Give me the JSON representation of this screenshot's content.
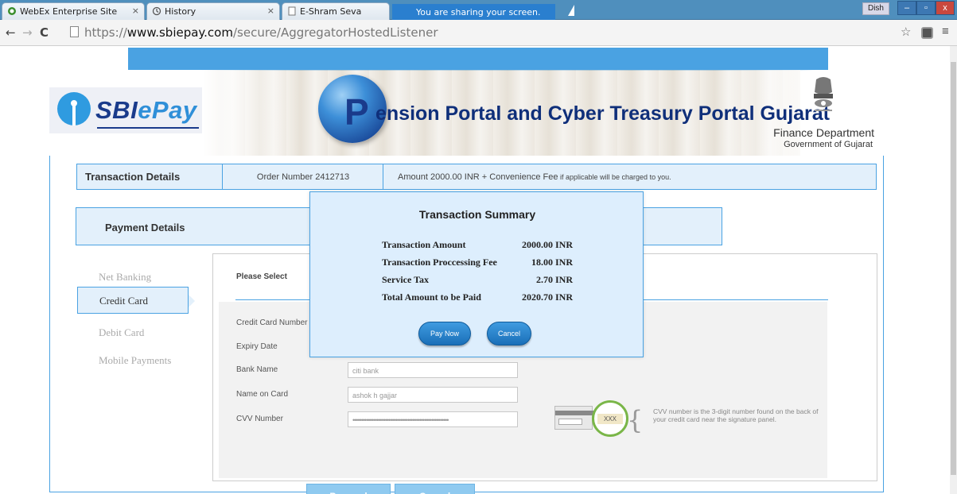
{
  "browser": {
    "tabs": [
      {
        "label": "WebEx Enterprise Site"
      },
      {
        "label": "History"
      },
      {
        "label": "E-Shram Seva"
      }
    ],
    "share_banner": "You are sharing your screen.",
    "user_badge": "Dish",
    "url_prefix": "https://",
    "url_host": "www.sbiepay.com",
    "url_path": "/secure/AggregatorHostedListener"
  },
  "header": {
    "logo_text_dark": "SBI",
    "logo_text_blue": "ePay",
    "portal_initial": "P",
    "portal_title": "ension Portal and Cyber Treasury Portal Gujarat",
    "department": "Finance Department",
    "government": "Government of Gujarat"
  },
  "transaction": {
    "label": "Transaction Details",
    "order_number": "Order Number 2412713",
    "amount_text": "Amount 2000.00 INR + Convenience Fee",
    "amount_note": " if applicable will be charged to you."
  },
  "payment_details_label": "Payment Details",
  "payment_methods": [
    {
      "label": "Net Banking",
      "active": false
    },
    {
      "label": "Credit Card",
      "active": true
    },
    {
      "label": "Debit Card",
      "active": false
    },
    {
      "label": "Mobile Payments",
      "active": false
    }
  ],
  "form": {
    "please_select": "Please Select",
    "card_number_label": "Credit Card Number",
    "expiry_label": "Expiry Date",
    "bank_label": "Bank Name",
    "bank_value": "citi bank",
    "name_label": "Name on Card",
    "name_value": "ashok h gajjar",
    "cvv_label": "CVV Number",
    "cvv_value": "••••••••••••••••••••••••••••••••••••••••••••••••••••••••",
    "cvv_image_text": "XXX",
    "cvv_help": "CVV number is the 3-digit number found on the back of your credit card near the signature panel.",
    "proceed_label": "Proceed",
    "cancel_label": "Cancel"
  },
  "summary": {
    "title": "Transaction Summary",
    "rows": [
      {
        "label": "Transaction Amount",
        "value": "2000.00 INR"
      },
      {
        "label": "Transaction Proccessing Fee",
        "value": "18.00 INR"
      },
      {
        "label": "Service Tax",
        "value": "2.70 INR"
      },
      {
        "label": "Total Amount to be Paid",
        "value": "2020.70 INR"
      }
    ],
    "pay_now_label": "Pay Now",
    "cancel_label": "Cancel"
  },
  "colors": {
    "accent": "#4aa2e2",
    "panel_bg": "#e3f0fb",
    "modal_bg": "#ddeefd",
    "title_navy": "#0f2f7a"
  }
}
